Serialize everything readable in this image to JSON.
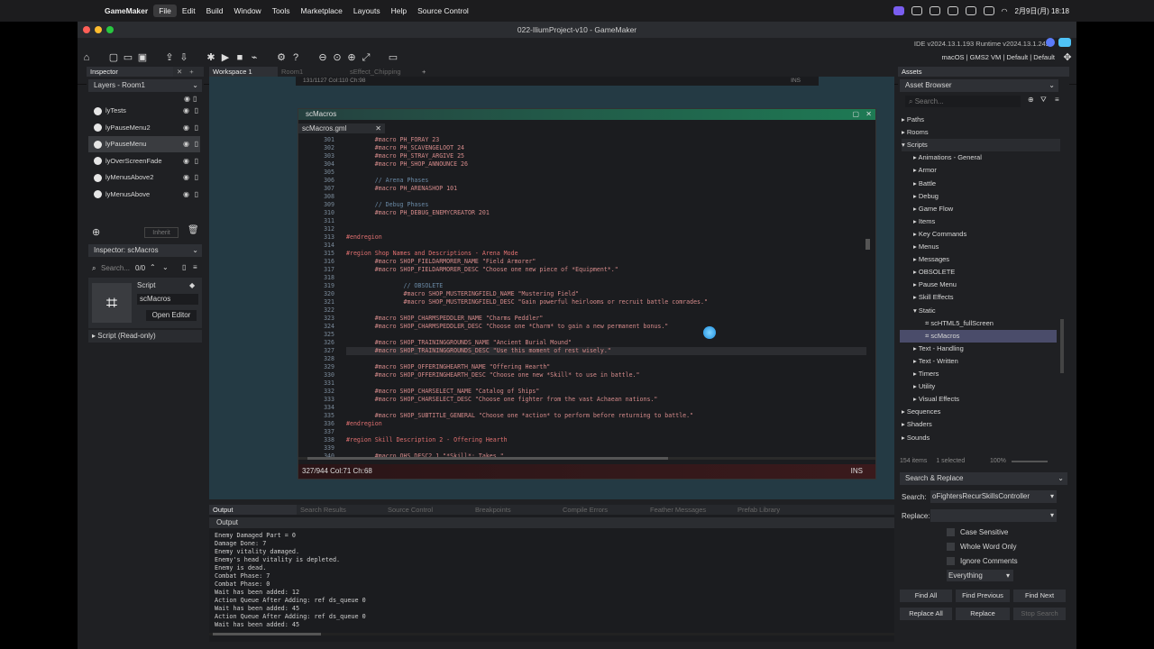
{
  "menubar": {
    "app": "GameMaker",
    "items": [
      "File",
      "Edit",
      "Build",
      "Window",
      "Tools",
      "Marketplace",
      "Layouts",
      "Help",
      "Source Control"
    ],
    "clock": "2月9日(月)  18:18"
  },
  "window": {
    "title": "022-IliumProject-v10 - GameMaker",
    "ide_version": "IDE v2024.13.1.193  Runtime v2024.13.1.242",
    "target": "macOS | GMS2 VM | Default | Default"
  },
  "inspector": {
    "tab": "Inspector",
    "layers_title": "Layers - Room1",
    "layers": [
      "lyTests",
      "lyPauseMenu2",
      "lyPauseMenu",
      "lyOverScreenFade",
      "lyMenusAbove2",
      "lyMenusAbove"
    ],
    "inherit": "Inherit",
    "inspector_title": "Inspector: scMacros",
    "search_placeholder": "Search...",
    "counter": "0/0",
    "script_label": "Script",
    "script_name": "scMacros",
    "open_editor": "Open Editor",
    "script_readonly": "Script (Read-only)"
  },
  "workspace": {
    "tabs": [
      "Workspace 1",
      "Room1",
      "sEffect_Chipping"
    ],
    "top_status": "131/1127 Col:110 Ch:98",
    "top_ins": "INS"
  },
  "editor": {
    "window_title": "scMacros",
    "file_tab": "scMacros.gml",
    "status": "327/944 Col:71 Ch:68",
    "ins": "INS"
  },
  "code_lines": [
    {
      "n": "301",
      "t": "        #macro PH_FORAY 23"
    },
    {
      "n": "302",
      "t": "        #macro PH_SCAVENGELOOT 24"
    },
    {
      "n": "303",
      "t": "        #macro PH_STRAY_ARGIVE 25"
    },
    {
      "n": "304",
      "t": "        #macro PH_SHOP_ANNOUNCE 26"
    },
    {
      "n": "305",
      "t": ""
    },
    {
      "n": "306",
      "t": "        // Arena Phases"
    },
    {
      "n": "307",
      "t": "        #macro PH_ARENASHOP 101"
    },
    {
      "n": "308",
      "t": ""
    },
    {
      "n": "309",
      "t": "        // Debug Phases"
    },
    {
      "n": "310",
      "t": "        #macro PH_DEBUG_ENEMYCREATOR 201"
    },
    {
      "n": "311",
      "t": ""
    },
    {
      "n": "312",
      "t": ""
    },
    {
      "n": "313",
      "t": "#endregion"
    },
    {
      "n": "314",
      "t": ""
    },
    {
      "n": "315",
      "t": "#region Shop Names and Descriptions - Arena Mode"
    },
    {
      "n": "316",
      "t": "        #macro SHOP_FIELDARMORER_NAME \"Field Armorer\""
    },
    {
      "n": "317",
      "t": "        #macro SHOP_FIELDARMORER_DESC \"Choose one new piece of *Equipment*.\""
    },
    {
      "n": "318",
      "t": ""
    },
    {
      "n": "319",
      "t": "                // OBSOLETE"
    },
    {
      "n": "320",
      "t": "                #macro SHOP_MUSTERINGFIELD_NAME \"Mustering Field\""
    },
    {
      "n": "321",
      "t": "                #macro SHOP_MUSTERINGFIELD_DESC \"Gain powerful heirlooms or recruit battle comrades.\""
    },
    {
      "n": "322",
      "t": ""
    },
    {
      "n": "323",
      "t": "        #macro SHOP_CHARMSPEDDLER_NAME \"Charms Peddler\""
    },
    {
      "n": "324",
      "t": "        #macro SHOP_CHARMSPEDDLER_DESC \"Choose one *Charm* to gain a new permanent bonus.\""
    },
    {
      "n": "325",
      "t": ""
    },
    {
      "n": "326",
      "t": "        #macro SHOP_TRAININGGROUNDS_NAME \"Ancient Burial Mound\""
    },
    {
      "n": "327",
      "t": "        #macro SHOP_TRAININGGROUNDS_DESC \"Use this moment of rest wisely.\""
    },
    {
      "n": "328",
      "t": ""
    },
    {
      "n": "329",
      "t": "        #macro SHOP_OFFERINGHEARTH_NAME \"Offering Hearth\""
    },
    {
      "n": "330",
      "t": "        #macro SHOP_OFFERINGHEARTH_DESC \"Choose one new *Skill* to use in battle.\""
    },
    {
      "n": "331",
      "t": ""
    },
    {
      "n": "332",
      "t": "        #macro SHOP_CHARSELECT_NAME \"Catalog of Ships\""
    },
    {
      "n": "333",
      "t": "        #macro SHOP_CHARSELECT_DESC \"Choose one fighter from the vast Achaean nations.\""
    },
    {
      "n": "334",
      "t": ""
    },
    {
      "n": "335",
      "t": "        #macro SHOP_SUBTITLE_GENERAL \"Choose one *action* to perform before returning to battle.\""
    },
    {
      "n": "336",
      "t": "#endregion"
    },
    {
      "n": "337",
      "t": ""
    },
    {
      "n": "338",
      "t": "#region Skill Description 2 - Offering Hearth"
    },
    {
      "n": "339",
      "t": ""
    },
    {
      "n": "340",
      "t": "        #macro OHS_DESC2_1 \"*Skill*: Takes \""
    }
  ],
  "output": {
    "tabs": [
      "Output",
      "Search Results",
      "Source Control",
      "Breakpoints",
      "Compile Errors",
      "Feather Messages",
      "Prefab Library"
    ],
    "header": "Output",
    "lines": [
      "Enemy Damaged Part = 0",
      "Damage Done: 7",
      "Enemy vitality damaged.",
      "Enemy's head vitality is depleted.",
      "Enemy is dead.",
      "Combat Phase: 7",
      "Combat Phase: 0",
      "Wait has been added: 12",
      "Action Queue After Adding: ref ds_queue 0",
      "Wait has been added: 45",
      "Action Queue After Adding: ref ds_queue 0",
      "Wait has been added: 45"
    ]
  },
  "assets": {
    "tab": "Assets",
    "title": "Asset Browser",
    "search_placeholder": "Search...",
    "items": [
      {
        "label": "Paths",
        "level": 0,
        "open": false
      },
      {
        "label": "Rooms",
        "level": 0,
        "open": false
      },
      {
        "label": "Scripts",
        "level": 0,
        "open": true
      },
      {
        "label": "Animations - General",
        "level": 1,
        "open": false
      },
      {
        "label": "Armor",
        "level": 1,
        "open": false
      },
      {
        "label": "Battle",
        "level": 1,
        "open": false
      },
      {
        "label": "Debug",
        "level": 1,
        "open": false
      },
      {
        "label": "Game Flow",
        "level": 1,
        "open": false
      },
      {
        "label": "Items",
        "level": 1,
        "open": false
      },
      {
        "label": "Key Commands",
        "level": 1,
        "open": false
      },
      {
        "label": "Menus",
        "level": 1,
        "open": false
      },
      {
        "label": "Messages",
        "level": 1,
        "open": false
      },
      {
        "label": "OBSOLETE",
        "level": 1,
        "open": false
      },
      {
        "label": "Pause Menu",
        "level": 1,
        "open": false
      },
      {
        "label": "Skill Effects",
        "level": 1,
        "open": false
      },
      {
        "label": "Static",
        "level": 1,
        "open": true
      },
      {
        "label": "scHTML5_fullScreen",
        "level": 2,
        "open": false
      },
      {
        "label": "scMacros",
        "level": 2,
        "open": false
      },
      {
        "label": "Text - Handling",
        "level": 1,
        "open": false
      },
      {
        "label": "Text - Written",
        "level": 1,
        "open": false
      },
      {
        "label": "Timers",
        "level": 1,
        "open": false
      },
      {
        "label": "Utility",
        "level": 1,
        "open": false
      },
      {
        "label": "Visual Effects",
        "level": 1,
        "open": false
      },
      {
        "label": "Sequences",
        "level": 0,
        "open": false
      },
      {
        "label": "Shaders",
        "level": 0,
        "open": false
      },
      {
        "label": "Sounds",
        "level": 0,
        "open": false
      }
    ],
    "count": "154 items",
    "selected": "1 selected",
    "zoom": "100%"
  },
  "search": {
    "title": "Search & Replace",
    "search_label": "Search:",
    "search_value": "oFightersRecurSkillsController",
    "replace_label": "Replace:",
    "replace_value": "",
    "options": [
      "Case Sensitive",
      "Whole Word Only",
      "Ignore Comments"
    ],
    "scope": "Everything",
    "buttons": [
      "Find All",
      "Find Previous",
      "Find Next",
      "Replace All",
      "Replace",
      "Stop Search"
    ]
  }
}
